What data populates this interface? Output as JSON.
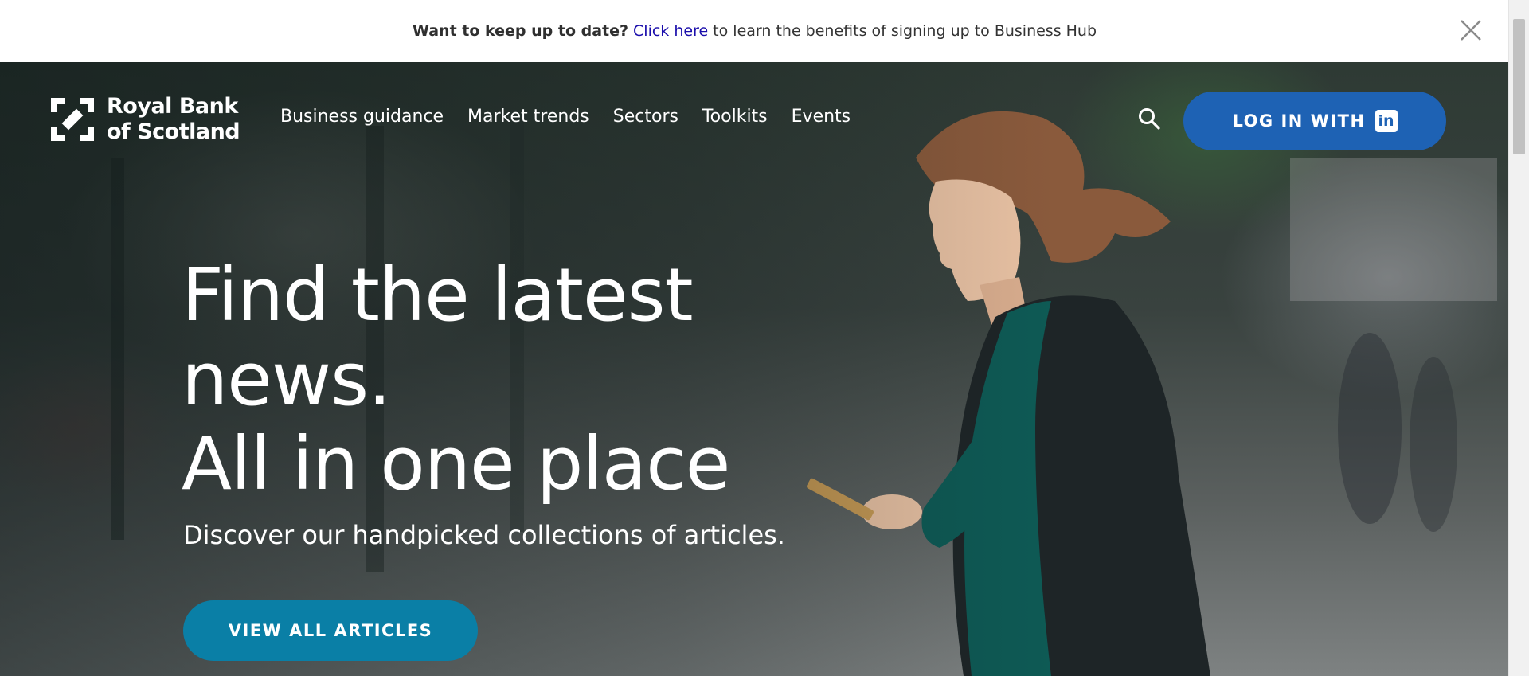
{
  "banner": {
    "lead": "Want to keep up to date?",
    "link": "Click here",
    "rest": "to learn the benefits of signing up to Business Hub",
    "close_icon": "close-icon"
  },
  "header": {
    "logo_line1": "Royal Bank",
    "logo_line2": "of Scotland",
    "nav": [
      {
        "label": "Business guidance"
      },
      {
        "label": "Market trends"
      },
      {
        "label": "Sectors"
      },
      {
        "label": "Toolkits"
      },
      {
        "label": "Events"
      }
    ],
    "search_icon": "search-icon",
    "login_label": "LOG IN WITH",
    "login_icon": "linkedin-icon"
  },
  "hero": {
    "headline_line1": "Find the latest",
    "headline_line2": "news.",
    "headline_line3": "All in one place",
    "subheading": "Discover our handpicked collections of articles.",
    "cta_label": "VIEW ALL ARTICLES"
  },
  "colors": {
    "login_button": "#1e62b4",
    "cta_button": "#0a7fa6",
    "link": "#1a0dab"
  }
}
